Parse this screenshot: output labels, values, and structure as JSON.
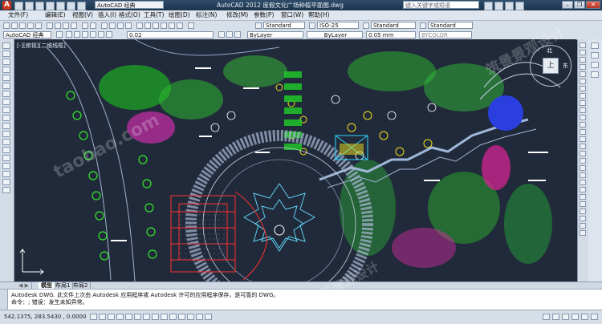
{
  "titlebar": {
    "app_icon": "A",
    "workspace": "AutoCAD 经典",
    "title": "AutoCAD 2012   度假文化广场种植平面图.dwg",
    "search_placeholder": "键入关键字或短语"
  },
  "menu": [
    "文件(F)",
    "编辑(E)",
    "视图(V)",
    "插入(I)",
    "格式(O)",
    "工具(T)",
    "绘图(D)",
    "标注(N)",
    "修改(M)",
    "参数(P)",
    "窗口(W)",
    "帮助(H)"
  ],
  "toolbar1": {
    "text_style": "Standard",
    "dim_style": "ISO-25",
    "table_style": "Standard",
    "multileader_style": "Standard"
  },
  "toolbar2": {
    "workspace": "AutoCAD 经典",
    "layer": "0.02",
    "color": "ByLayer",
    "lineweight": "0.05 mm",
    "plot_style": "BYCOLOR"
  },
  "viewport_label": "[-][俯视][二维线框]",
  "viewcube": {
    "north": "北",
    "top": "上",
    "east": "东"
  },
  "layout_tabs": [
    "模型",
    "布局1",
    "布局2"
  ],
  "command_lines": [
    "Autodesk DWG.   此文件上次由 Autodesk 应用程序或 Autodesk 许可的应用程序保存，是可靠的 DWG。",
    "命令：; 错误：发生未知异常。"
  ],
  "status": {
    "coords": "542.1375, 283.5430 , 0.0000"
  },
  "watermark": {
    "cn": "筑景景观设计",
    "url": "taobao.com"
  },
  "colors": {
    "canvas_bg": "#212a3a",
    "accent_yellow": "#f6e316",
    "accent_green": "#3dff2b",
    "accent_magenta": "#ff2db4"
  }
}
